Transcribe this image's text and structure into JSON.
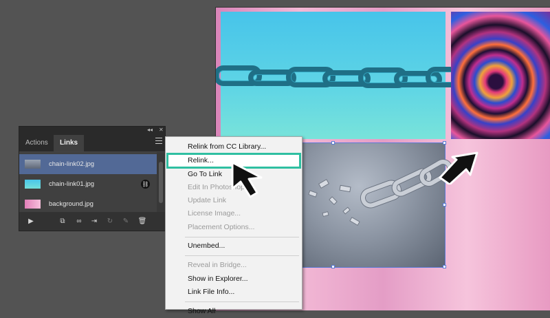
{
  "panel": {
    "tabs": [
      "Actions",
      "Links"
    ],
    "active_tab": "Links",
    "links": [
      {
        "name": "chain-link02.jpg",
        "selected": true
      },
      {
        "name": "chain-link01.jpg",
        "selected": false,
        "badge_icon": "link-icon"
      },
      {
        "name": "background.jpg",
        "selected": false
      }
    ],
    "toolbar_icons": [
      "play-icon",
      "relink-from-library-icon",
      "relink-icon",
      "go-to-link-icon",
      "update-link-icon",
      "edit-original-icon",
      "delete-icon"
    ]
  },
  "context_menu": {
    "items": [
      {
        "label": "Relink from CC Library...",
        "enabled": true
      },
      {
        "label": "Relink...",
        "enabled": true,
        "highlighted": true
      },
      {
        "label": "Go To Link",
        "enabled": true
      },
      {
        "label": "Edit In Photoshop",
        "enabled": false
      },
      {
        "label": "Update Link",
        "enabled": false
      },
      {
        "label": "License Image...",
        "enabled": false
      },
      {
        "label": "Placement Options...",
        "enabled": false
      },
      {
        "label": "Unembed...",
        "enabled": true
      },
      {
        "label": "Reveal in Bridge...",
        "enabled": false
      },
      {
        "label": "Show in Explorer...",
        "enabled": true
      },
      {
        "label": "Link File Info...",
        "enabled": true
      },
      {
        "label": "Show All",
        "enabled": true
      }
    ]
  },
  "colors": {
    "workspace": "#535353",
    "panel": "#323232",
    "selection": "#526996",
    "highlight_outline": "#2fbfa1",
    "menu_bg": "#f2f2f2"
  }
}
